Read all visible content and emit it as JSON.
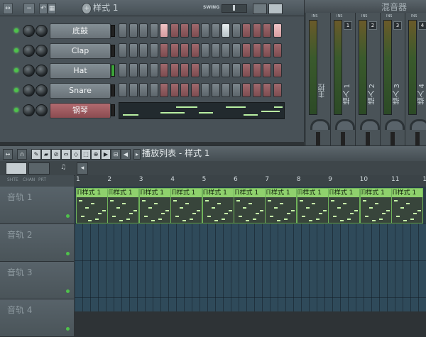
{
  "rack": {
    "title": "样式 1",
    "swing_label": "SWING",
    "channels": [
      {
        "name": "底鼓",
        "steps": "0000100000100001"
      },
      {
        "name": "Clap",
        "steps": "0000000000000000"
      },
      {
        "name": "Hat",
        "steps": "0000000000000000"
      },
      {
        "name": "Snare",
        "steps": "0000000000000000"
      },
      {
        "name": "钢琴",
        "steps": ""
      }
    ]
  },
  "mixer": {
    "title": "混音器",
    "channels": [
      {
        "label": "主控",
        "num": ""
      },
      {
        "label": "插入 1",
        "num": "1"
      },
      {
        "label": "插入 2",
        "num": "2"
      },
      {
        "label": "插入 3",
        "num": "3"
      },
      {
        "label": "插入 4",
        "num": "4"
      }
    ],
    "ins_label": "INS"
  },
  "playlist": {
    "title": "播放列表 - 样式 1",
    "head_labels": [
      "SHTE",
      "CHAN",
      "PRT"
    ],
    "bar_numbers": [
      "1",
      "2",
      "3",
      "4",
      "5",
      "6",
      "7",
      "8",
      "9",
      "10",
      "11",
      "12"
    ],
    "tracks": [
      "音轨 1",
      "音轨 2",
      "音轨 3",
      "音轨 4"
    ],
    "clip_label": "样式 1"
  },
  "colors": {
    "clip_head": "#8fd16d",
    "led_green": "#4ec24a",
    "step_red": "#a0696d",
    "step_grey": "#7c868c"
  }
}
